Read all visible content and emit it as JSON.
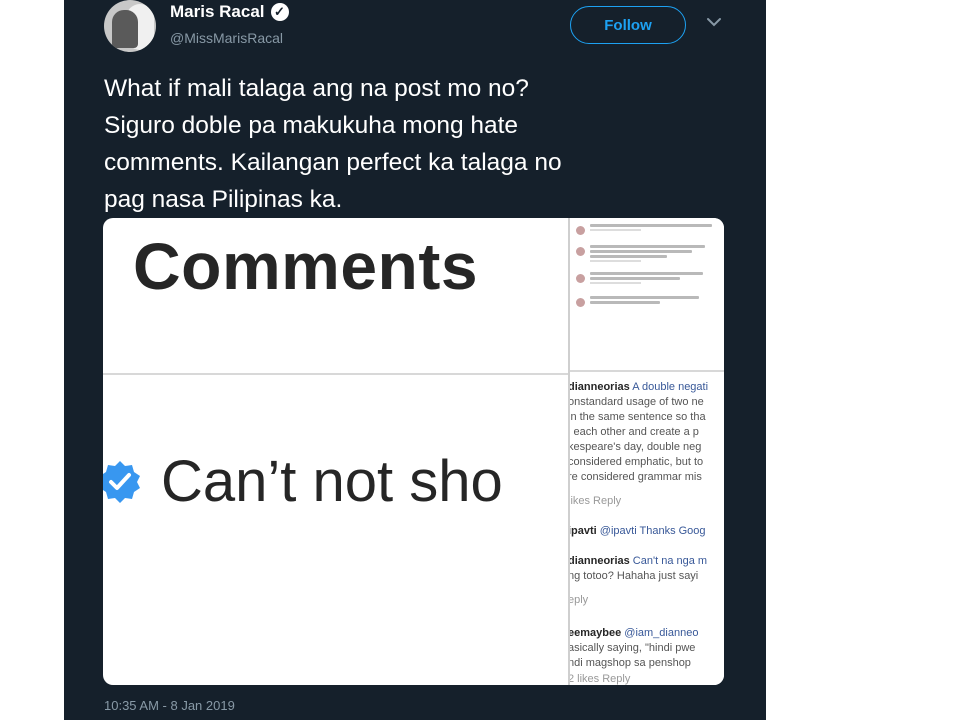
{
  "tweet": {
    "author_name": "Maris Racal",
    "author_handle": "@MissMarisRacal",
    "follow_label": "Follow",
    "text": "What if mali talaga ang na post mo no?\nSiguro doble pa makukuha mong hate\ncomments. Kailangan perfect ka talaga no\npag nasa Pilipinas ka.",
    "timestamp": "10:35 AM - 8 Jan 2019",
    "colors": {
      "background": "#15202b",
      "accent": "#1da1f2",
      "muted": "#8899a6"
    }
  },
  "media": {
    "comments_heading": "Comments",
    "big_text": "Can’t not sho",
    "lines": [
      {
        "kind": "user",
        "text": "dianneorias A double negati",
        "user": "dianneorias",
        "rest": " A double negati"
      },
      {
        "kind": "body",
        "text": "onstandard usage of two ne"
      },
      {
        "kind": "body",
        "text": "in the same sentence so tha"
      },
      {
        "kind": "body",
        "text": "l each other and create a p"
      },
      {
        "kind": "body",
        "text": "kespeare's day, double neg"
      },
      {
        "kind": "body",
        "text": "considered emphatic, but to"
      },
      {
        "kind": "body",
        "text": "re considered grammar mis"
      },
      {
        "kind": "meta",
        "text": "likes    Reply"
      },
      {
        "kind": "user",
        "text": "ipavti @ipavti Thanks Goog",
        "user": "ipavti",
        "rest": " @ipavti Thanks Goog"
      },
      {
        "kind": "user",
        "text": "dianneorias Can't na nga m",
        "user": "dianneorias",
        "rest": " Can't na nga m"
      },
      {
        "kind": "body",
        "text": "ng totoo? Hahaha just sayi"
      },
      {
        "kind": "meta",
        "text": "eply"
      },
      {
        "kind": "user",
        "text": "eemaybee @iam_dianneo",
        "user": "eemaybee",
        "rest": " @iam_dianneo"
      },
      {
        "kind": "body",
        "text": "asically saying, \"hindi pwe"
      },
      {
        "kind": "body",
        "text": "ndi magshop sa penshop"
      },
      {
        "kind": "meta",
        "text": "    2 likes    Reply"
      }
    ]
  }
}
